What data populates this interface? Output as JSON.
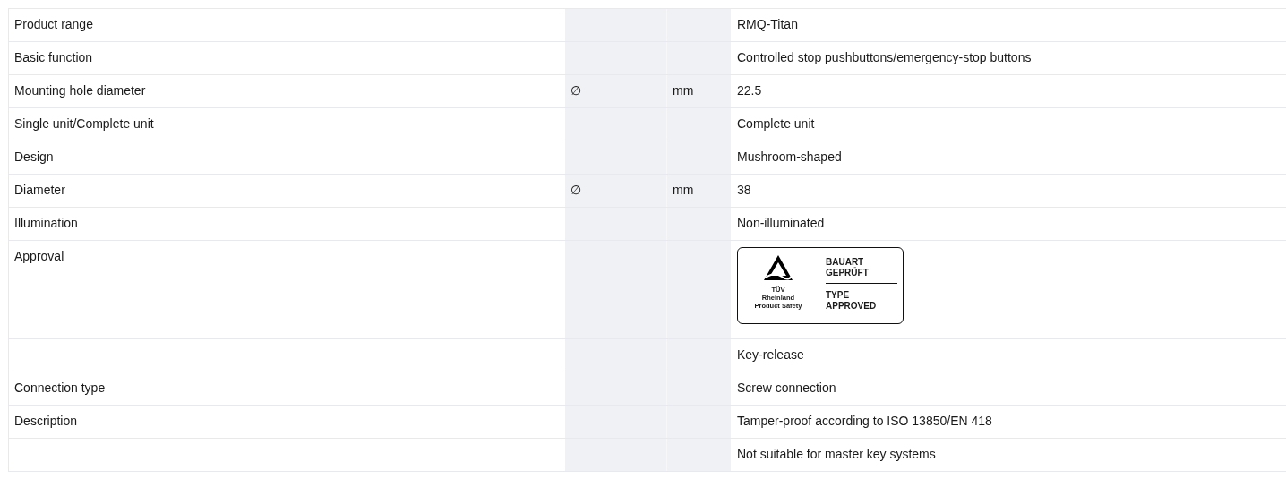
{
  "rows": [
    {
      "label": "Product range",
      "symbol": "",
      "unit": "",
      "kind": "text",
      "value": "RMQ-Titan"
    },
    {
      "label": "Basic function",
      "symbol": "",
      "unit": "",
      "kind": "text",
      "value": "Controlled stop pushbuttons/emergency-stop buttons"
    },
    {
      "label": "Mounting hole diameter",
      "symbol": "∅",
      "unit": "mm",
      "kind": "text",
      "value": "22.5"
    },
    {
      "label": "Single unit/Complete unit",
      "symbol": "",
      "unit": "",
      "kind": "text",
      "value": "Complete unit"
    },
    {
      "label": "Design",
      "symbol": "",
      "unit": "",
      "kind": "text",
      "value": "Mushroom-shaped"
    },
    {
      "label": "Diameter",
      "symbol": "∅",
      "unit": "mm",
      "kind": "text",
      "value": "38"
    },
    {
      "label": "Illumination",
      "symbol": "",
      "unit": "",
      "kind": "text",
      "value": "Non-illuminated"
    },
    {
      "label": "Approval",
      "symbol": "",
      "unit": "",
      "kind": "certificate",
      "certificate": {
        "org_lines": [
          "TÜV",
          "Rheinland",
          "Product Safety"
        ],
        "top_lines": [
          "BAUART",
          "GEPRÜFT"
        ],
        "bottom_lines": [
          "TYPE",
          "APPROVED"
        ]
      }
    },
    {
      "label": "",
      "symbol": "",
      "unit": "",
      "kind": "text",
      "value": "Key-release"
    },
    {
      "label": "Connection type",
      "symbol": "",
      "unit": "",
      "kind": "text",
      "value": "Screw connection"
    },
    {
      "label": "Description",
      "symbol": "",
      "unit": "",
      "kind": "text",
      "value": "Tamper-proof according to ISO 13850/EN 418"
    },
    {
      "label": "",
      "symbol": "",
      "unit": "",
      "kind": "text",
      "value": "Not suitable for master key systems"
    }
  ]
}
